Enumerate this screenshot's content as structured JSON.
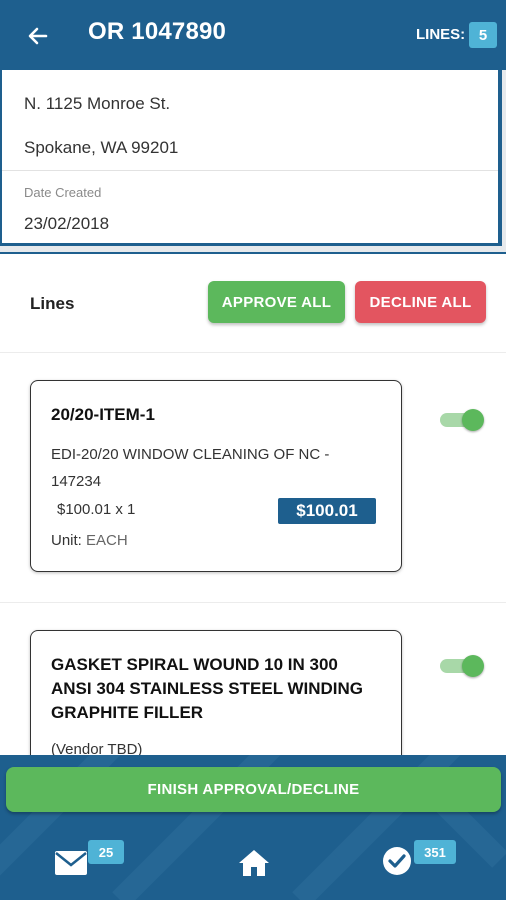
{
  "header": {
    "title": "OR 1047890",
    "lines_label": "LINES:",
    "lines_count": "5"
  },
  "address": {
    "partial_line": "...",
    "line1": "N. 1125 Monroe St.",
    "line2": "Spokane, WA 99201"
  },
  "date": {
    "label": "Date Created",
    "value": "23/02/2018"
  },
  "lines_section": {
    "label": "Lines",
    "approve_all": "APPROVE ALL",
    "decline_all": "DECLINE ALL"
  },
  "items": [
    {
      "title": "20/20-ITEM-1",
      "description": "EDI-20/20 WINDOW CLEANING OF NC - 147234",
      "calc": "$100.01 x 1",
      "total": "$100.01",
      "unit_label": "Unit:",
      "unit_value": "EACH",
      "approved": true
    },
    {
      "title": "GASKET SPIRAL WOUND 10 IN 300 ANSI 304 STAINLESS STEEL WINDING GRAPHITE FILLER",
      "description": "(Vendor TBD)",
      "approved": true
    }
  ],
  "finish_button": "FINISH APPROVAL/DECLINE",
  "bottom_nav": {
    "mail_count": "25",
    "approvals_count": "351"
  },
  "colors": {
    "primary": "#1e5f8e",
    "approve": "#5cb85c",
    "decline": "#e35560",
    "badge": "#4fb3d6"
  },
  "icons": [
    "back-arrow-icon",
    "mail-icon",
    "home-icon",
    "check-circle-icon"
  ]
}
